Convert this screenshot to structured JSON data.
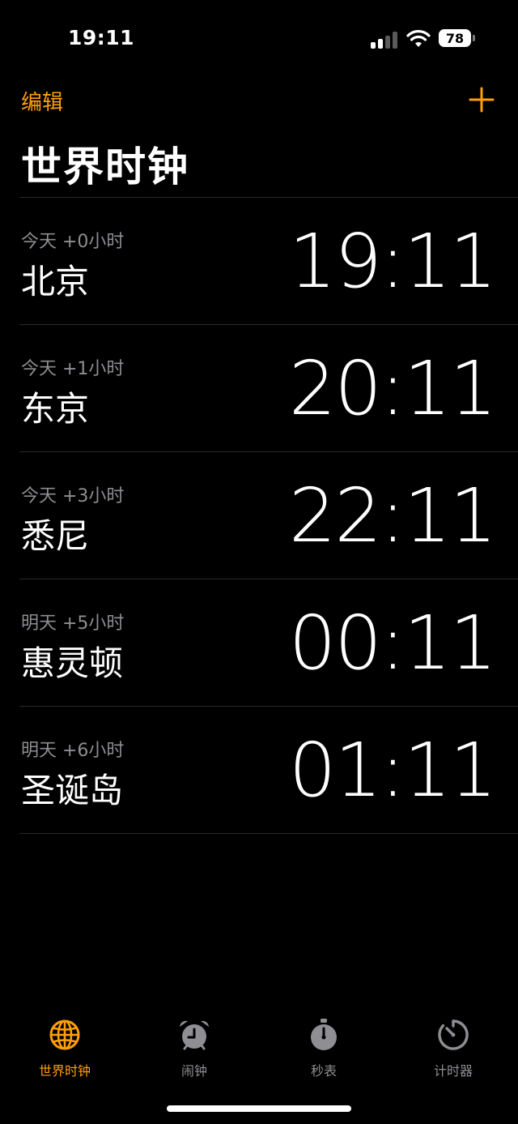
{
  "status_bar": {
    "time": "19:11",
    "battery": "78"
  },
  "nav": {
    "edit_label": "编辑",
    "title": "世界时钟"
  },
  "clocks": [
    {
      "offset": "今天 +0小时",
      "city": "北京",
      "time": "19:11"
    },
    {
      "offset": "今天 +1小时",
      "city": "东京",
      "time": "20:11"
    },
    {
      "offset": "今天 +3小时",
      "city": "悉尼",
      "time": "22:11"
    },
    {
      "offset": "明天 +5小时",
      "city": "惠灵顿",
      "time": "00:11"
    },
    {
      "offset": "明天 +6小时",
      "city": "圣诞岛",
      "time": "01:11"
    }
  ],
  "tabs": [
    {
      "label": "世界时钟",
      "icon": "globe-icon",
      "active": true
    },
    {
      "label": "闹钟",
      "icon": "alarm-clock-icon",
      "active": false
    },
    {
      "label": "秒表",
      "icon": "stopwatch-icon",
      "active": false
    },
    {
      "label": "计时器",
      "icon": "timer-icon",
      "active": false
    }
  ],
  "colors": {
    "accent": "#ff9f0a",
    "inactive": "#8e8e93",
    "background": "#000000"
  }
}
